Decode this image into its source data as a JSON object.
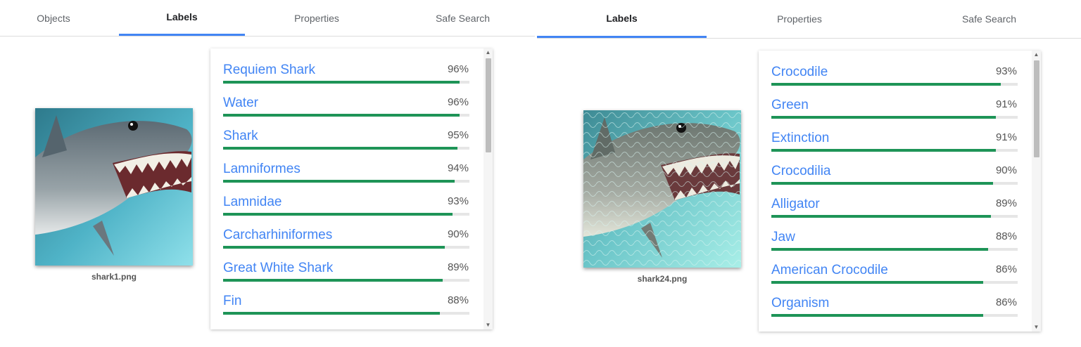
{
  "left": {
    "tabs": [
      {
        "label": "Objects",
        "active": false
      },
      {
        "label": "Labels",
        "active": true
      },
      {
        "label": "Properties",
        "active": false
      },
      {
        "label": "Safe Search",
        "active": false
      }
    ],
    "image": {
      "filename": "shark1.png"
    },
    "labels": [
      {
        "name": "Requiem Shark",
        "percent": "96%",
        "score": 0.96
      },
      {
        "name": "Water",
        "percent": "96%",
        "score": 0.96
      },
      {
        "name": "Shark",
        "percent": "95%",
        "score": 0.95
      },
      {
        "name": "Lamniformes",
        "percent": "94%",
        "score": 0.94
      },
      {
        "name": "Lamnidae",
        "percent": "93%",
        "score": 0.93
      },
      {
        "name": "Carcharhiniformes",
        "percent": "90%",
        "score": 0.9
      },
      {
        "name": "Great White Shark",
        "percent": "89%",
        "score": 0.89
      },
      {
        "name": "Fin",
        "percent": "88%",
        "score": 0.88
      }
    ],
    "scroll_up_icon": "triangle-up",
    "scroll_down_icon": "triangle-down"
  },
  "right": {
    "tabs": [
      {
        "label": "Labels",
        "active": true
      },
      {
        "label": "Properties",
        "active": false
      },
      {
        "label": "Safe Search",
        "active": false
      }
    ],
    "image": {
      "filename": "shark24.png"
    },
    "labels": [
      {
        "name": "Crocodile",
        "percent": "93%",
        "score": 0.93
      },
      {
        "name": "Green",
        "percent": "91%",
        "score": 0.91
      },
      {
        "name": "Extinction",
        "percent": "91%",
        "score": 0.91
      },
      {
        "name": "Crocodilia",
        "percent": "90%",
        "score": 0.9
      },
      {
        "name": "Alligator",
        "percent": "89%",
        "score": 0.89
      },
      {
        "name": "Jaw",
        "percent": "88%",
        "score": 0.88
      },
      {
        "name": "American Crocodile",
        "percent": "86%",
        "score": 0.86
      },
      {
        "name": "Organism",
        "percent": "86%",
        "score": 0.86
      }
    ],
    "scroll_up_icon": "triangle-up",
    "scroll_down_icon": "triangle-down"
  },
  "colors": {
    "accent": "#4285f4",
    "bar": "#1e9457",
    "track": "#e6e6e6"
  }
}
